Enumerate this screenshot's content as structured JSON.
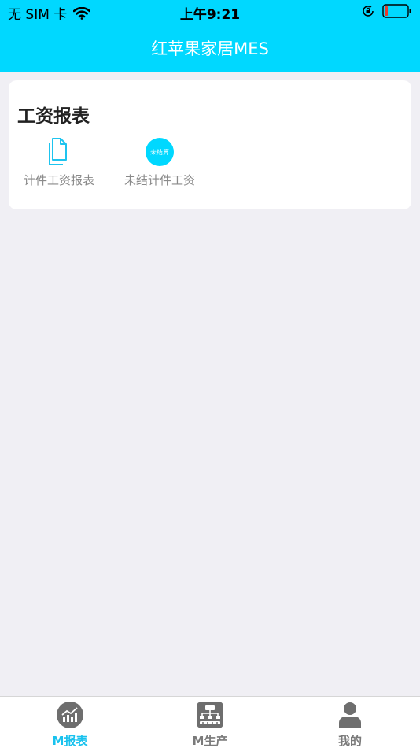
{
  "status_bar": {
    "carrier": "无 SIM 卡",
    "time": "上午9:21",
    "icons": [
      "wifi-icon",
      "orientation-lock-icon",
      "battery-icon"
    ]
  },
  "nav": {
    "title": "红苹果家居MES"
  },
  "card": {
    "title": "工资报表",
    "items": [
      {
        "label": "计件工资报表",
        "icon": "document-icon"
      },
      {
        "label": "未结计件工资",
        "badge_text": "未结算"
      }
    ]
  },
  "tabbar": {
    "active_color": "#19c2ee",
    "items": [
      {
        "label": "M报表",
        "icon": "chart-icon",
        "active": true
      },
      {
        "label": "M生产",
        "icon": "production-icon",
        "active": false
      },
      {
        "label": "我的",
        "icon": "user-icon",
        "active": false
      }
    ]
  },
  "colors": {
    "header": "#00d8ff",
    "background": "#f0eff4"
  }
}
